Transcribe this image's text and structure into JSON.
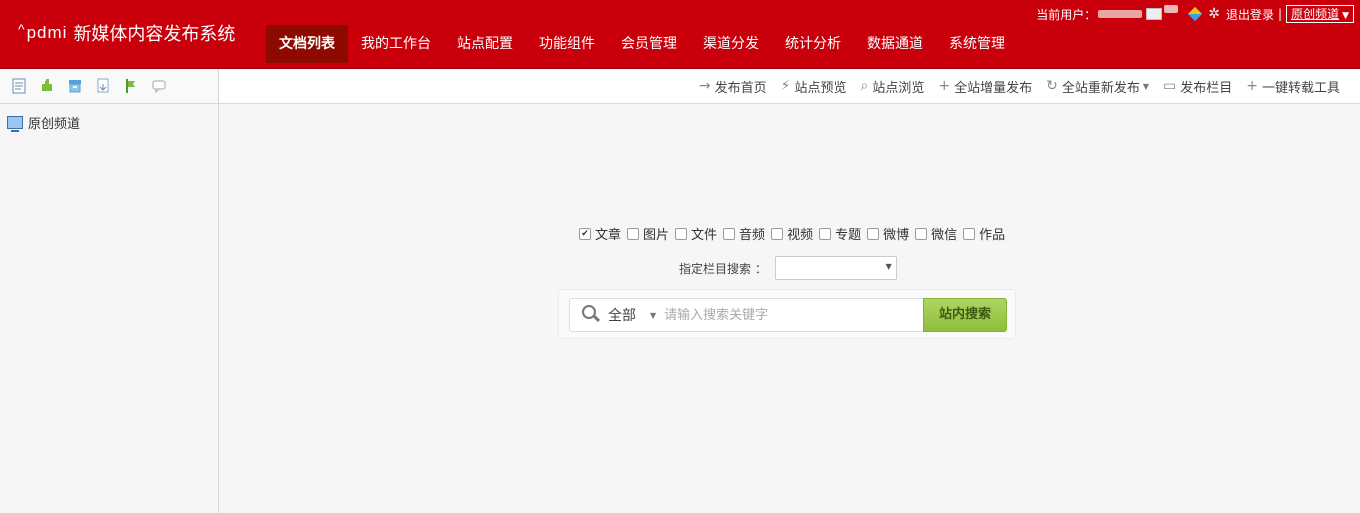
{
  "header": {
    "logo_mark": "pdmi",
    "logo_caret": "^",
    "system_title": "新媒体内容发布系统",
    "nav": [
      "文档列表",
      "我的工作台",
      "站点配置",
      "功能组件",
      "会员管理",
      "渠道分发",
      "统计分析",
      "数据通道",
      "系统管理"
    ],
    "active_nav": "文档列表",
    "user_label": "当前用户：",
    "logout": "退出登录",
    "separator": "|",
    "channel": "原创频道"
  },
  "left": {
    "toolbar_icons": [
      "new-document-icon",
      "plugin-icon",
      "archive-icon",
      "import-icon",
      "flag-icon",
      "comment-icon"
    ],
    "tree": [
      {
        "label": "原创频道",
        "icon": "monitor-icon"
      }
    ]
  },
  "toolbar": {
    "items": [
      {
        "label": "发布首页",
        "icon": "→"
      },
      {
        "label": "站点预览",
        "icon": "⚡"
      },
      {
        "label": "站点浏览",
        "icon": "⌕"
      },
      {
        "label": "全站增量发布",
        "icon": "+"
      },
      {
        "label": "全站重新发布",
        "icon": "↻",
        "dropdown": true
      },
      {
        "label": "发布栏目",
        "icon": "▭"
      },
      {
        "label": "一键转载工具",
        "icon": "+"
      }
    ]
  },
  "search": {
    "types": [
      {
        "label": "文章",
        "checked": true
      },
      {
        "label": "图片",
        "checked": false
      },
      {
        "label": "文件",
        "checked": false
      },
      {
        "label": "音频",
        "checked": false
      },
      {
        "label": "视频",
        "checked": false
      },
      {
        "label": "专题",
        "checked": false
      },
      {
        "label": "微博",
        "checked": false
      },
      {
        "label": "微信",
        "checked": false
      },
      {
        "label": "作品",
        "checked": false
      }
    ],
    "column_label": "指定栏目搜索 ：",
    "scope": "全部",
    "placeholder": "请输入搜索关键字",
    "button": "站内搜索"
  },
  "colors": {
    "header_red": "#c9000b",
    "active_nav": "#8e0a00",
    "search_button": "#9fc94b"
  }
}
